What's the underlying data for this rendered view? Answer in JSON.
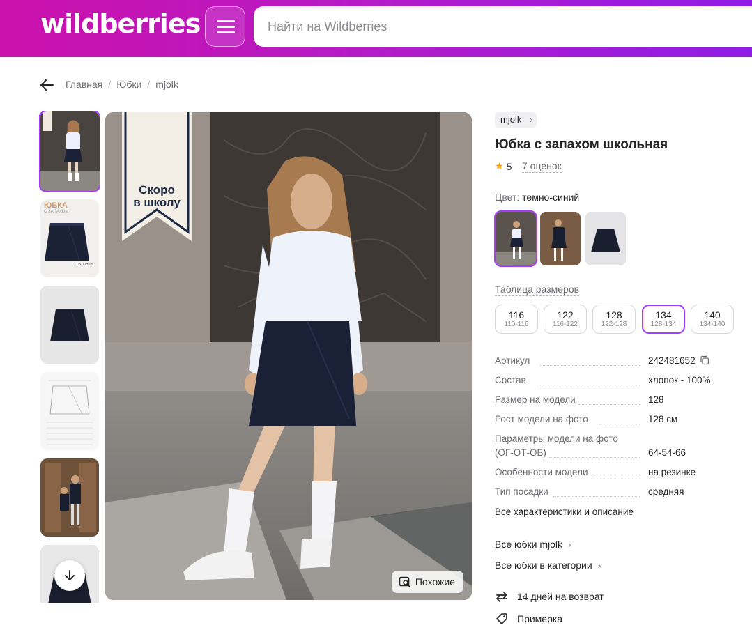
{
  "header": {
    "logo": "wildberries",
    "search_placeholder": "Найти на Wildberries"
  },
  "breadcrumb": [
    "Главная",
    "Юбки",
    "mjolk"
  ],
  "thumbnails": {
    "t2_title": "ЮБКА",
    "t2_sub": "С ЗАПАХОМ"
  },
  "main_image": {
    "banner_text_line1": "Скоро",
    "banner_text_line2": "в школу",
    "similar_label": "Похожие"
  },
  "product": {
    "brand": "mjolk",
    "title": "Юбка с запахом школьная",
    "rating": "5",
    "reviews": "7 оценок",
    "color_label": "Цвет:",
    "color_value": "темно-синий",
    "size_table_link": "Таблица размеров",
    "sizes": [
      {
        "main": "116",
        "sub": "110-116"
      },
      {
        "main": "122",
        "sub": "116-122"
      },
      {
        "main": "128",
        "sub": "122-128"
      },
      {
        "main": "134",
        "sub": "128-134"
      },
      {
        "main": "140",
        "sub": "134-140"
      }
    ],
    "selected_size": "134",
    "specs": [
      {
        "key": "Артикул",
        "value": "242481652"
      },
      {
        "key": "Состав",
        "value": "хлопок - 100%"
      },
      {
        "key": "Размер на модели",
        "value": "128"
      },
      {
        "key": "Рост модели на фото",
        "value": "128 см"
      },
      {
        "key": "Параметры модели на фото (ОГ-ОТ-ОБ)",
        "key_line1": "Параметры модели на фото",
        "key_line2": "(ОГ-ОТ-ОБ)",
        "value": "64-54-66"
      },
      {
        "key": "Особенности модели",
        "value": "на резинке"
      },
      {
        "key": "Тип посадки",
        "value": "средняя"
      }
    ],
    "all_specs_link": "Все характеристики и описание",
    "all_brand_link": "Все юбки mjolk",
    "all_category_link": "Все юбки в категории",
    "services": [
      {
        "label": "14 дней на возврат",
        "icon": "return-arrows-icon"
      },
      {
        "label": "Примерка",
        "icon": "tag-icon"
      }
    ]
  },
  "colors": {
    "accent": "#a73afd",
    "header_start": "#cb11ab",
    "header_end": "#8f1ce6",
    "star": "#ff9f00"
  }
}
